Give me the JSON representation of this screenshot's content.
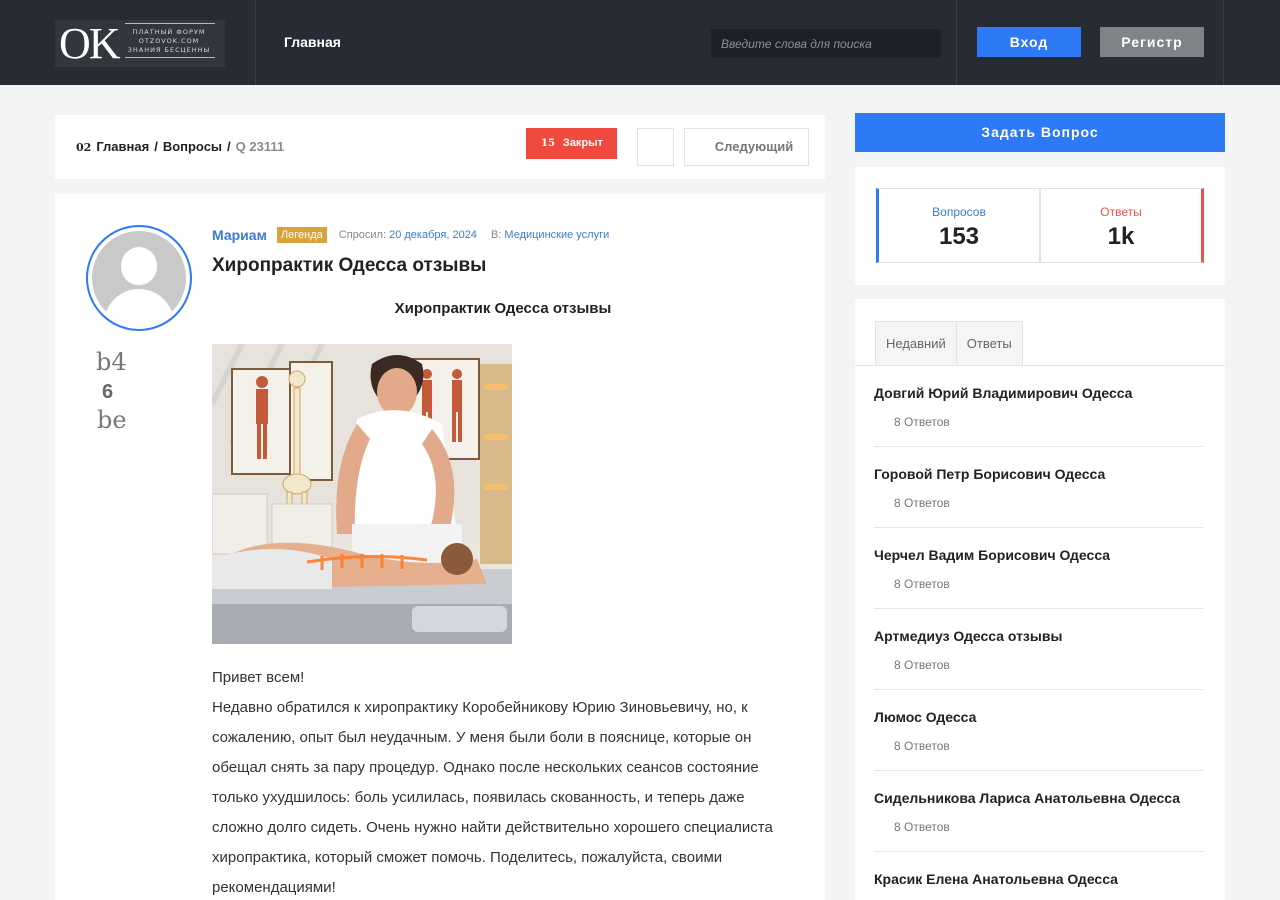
{
  "header": {
    "logo": {
      "mark": "OK",
      "line1": "ПЛАТНЫЙ ФОРУМ",
      "line2": "OTZOVOK.COM",
      "line3": "ЗНАНИЯ БЕСЦЕННЫ"
    },
    "nav_home": "Главная",
    "search_placeholder": "Введите слова для поиска",
    "login": "Вход",
    "register": "Регистр"
  },
  "breadcrumb": {
    "home_icon": "02",
    "home": "Главная",
    "questions": "Вопросы",
    "current": "Q 23111",
    "closed_count": "15",
    "closed_label": "Закрыт",
    "prev_icon": "",
    "next_label": "Следующий",
    "next_icon": ""
  },
  "question": {
    "author": "Мариам",
    "badge": "Легенда",
    "asked_label": "Спросил:",
    "asked_date": "20 декабря, 2024",
    "in_label": "В:",
    "category": "Медицинские услуги",
    "title": "Хиропрактик Одесса отзывы",
    "subtitle": "Хиропрактик Одесса отзывы",
    "vote_up": "b4",
    "vote_count": "6",
    "vote_down": "be",
    "body": [
      "Привет всем!",
      "Недавно обратился к хиропрактику Коробейникову Юрию Зиновьевичу, но, к сожалению, опыт был неудачным. У меня были боли в пояснице, которые он обещал снять за пару процедур. Однако после нескольких сеансов состояние только ухудшилось: боль усилилась, появилась скованность, и теперь даже сложно долго сидеть. Очень нужно найти действительно хорошего специалиста хиропрактика, который сможет помочь. Поделитесь, пожалуйста, своими рекомендациями!"
    ]
  },
  "sidebar": {
    "ask_button": "Задать Вопрос",
    "stats": {
      "questions_label": "Вопросов",
      "questions_value": "153",
      "answers_label": "Ответы",
      "answers_value": "1k"
    },
    "tabs": [
      "Недавний",
      "Ответы"
    ],
    "items": [
      {
        "title": "Довгий Юрий Владимирович Одесса",
        "answers": "8 Ответов",
        "icon": ""
      },
      {
        "title": "Горовой Петр Борисович Одесса",
        "answers": "8 Ответов",
        "icon": ""
      },
      {
        "title": "Черчел Вадим Борисович Одесса",
        "answers": "8 Ответов",
        "icon": ""
      },
      {
        "title": "Артмедиуз Одесса отзывы",
        "answers": "8 Ответов",
        "icon": ""
      },
      {
        "title": "Люмос Одесса",
        "answers": "8 Ответов",
        "icon": ""
      },
      {
        "title": "Сидельникова Лариса Анатольевна Одесса",
        "answers": "8 Ответов",
        "icon": ""
      },
      {
        "title": "Красик Елена Анатольевна Одесса",
        "answers": "",
        "icon": ""
      }
    ]
  },
  "colors": {
    "header_bg": "#272b34",
    "accent": "#2d79f6",
    "danger": "#f04a3e",
    "badge": "#d8a33a"
  }
}
